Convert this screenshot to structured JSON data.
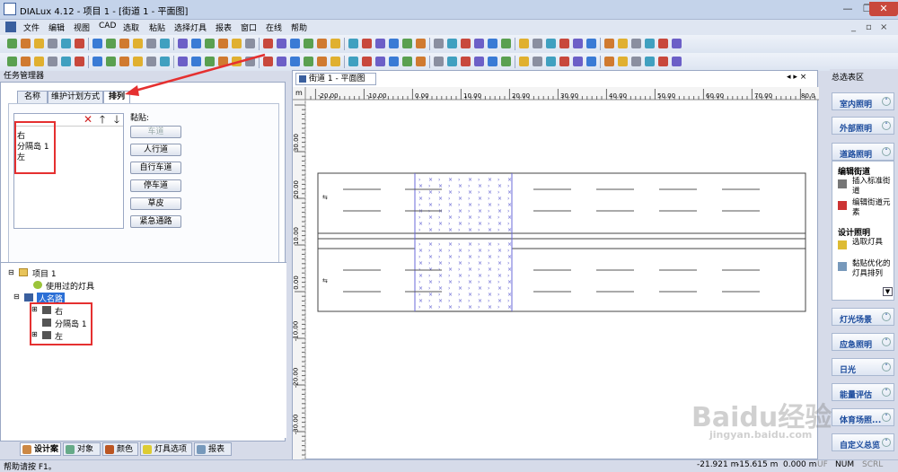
{
  "window": {
    "title": "DIALux 4.12 - 项目 1 - [街道 1 - 平面图]",
    "controls": [
      "—",
      "❐",
      "✕"
    ]
  },
  "menu": {
    "items": [
      "文件",
      "编辑",
      "视图",
      "CAD",
      "选取",
      "粘贴",
      "选择灯具",
      "报表",
      "窗口",
      "在线",
      "帮助"
    ],
    "mdi_controls": [
      "_",
      "▫",
      "×"
    ]
  },
  "left_panel": {
    "title": "任务管理器",
    "tabs": [
      "名称",
      "维护计划方式",
      "排列"
    ],
    "active_tab": "排列",
    "sort_list": [
      "右",
      "分隔岛 1",
      "左"
    ],
    "list_icons": [
      "delete-icon",
      "move-up-icon",
      "move-down-icon"
    ],
    "paste_label": "黏贴:",
    "paste_buttons": [
      "车道",
      "人行道",
      "自行车道",
      "停车道",
      "草皮",
      "紧急通路"
    ],
    "disabled_button": "车道",
    "tree": {
      "root": "项目 1",
      "used_luminaires": "使用过的灯具",
      "road": "人名路",
      "children": [
        "右",
        "分隔岛 1",
        "左"
      ]
    },
    "bottom_tabs": [
      "设计案",
      "对象",
      "颜色",
      "灯具选项",
      "报表"
    ]
  },
  "document": {
    "tab_title": "街道 1 - 平面图",
    "ruler_unit": "m",
    "h_ticks": [
      "-20.00",
      "-10.00",
      "0.00",
      "10.00",
      "20.00",
      "30.00",
      "40.00",
      "50.00",
      "60.00",
      "70.00",
      "80.0"
    ],
    "v_ticks": [
      "30.00",
      "20.00",
      "10.00",
      "0.00",
      "-10.00",
      "-20.00",
      "-30.00"
    ]
  },
  "right_panel": {
    "title": "总选表区",
    "buttons_top": [
      "室内照明",
      "外部照明",
      "道路照明"
    ],
    "road_section": {
      "edit_title": "编辑街道",
      "edit_items": [
        "插入标准街道",
        "编辑街道元素"
      ],
      "design_title": "设计照明",
      "design_items": [
        "选取灯具",
        "黏贴优化的灯具排列"
      ]
    },
    "buttons_bottom": [
      "灯光场景",
      "应急照明",
      "日光",
      "能量评估",
      "体育场照...",
      "自定义总览"
    ]
  },
  "status": {
    "help": "帮助请按 F1。",
    "x": "-21.921 m",
    "y": "-15.615 m",
    "z": "0.000 m",
    "uf": "UF",
    "num": "NUM",
    "scrl": "SCRL"
  },
  "watermark": {
    "brand": "Baidu经验",
    "url": "jingyan.baidu.com"
  },
  "colors": {
    "annotation_red": "#e53030",
    "accent_blue": "#1a4a9c"
  }
}
